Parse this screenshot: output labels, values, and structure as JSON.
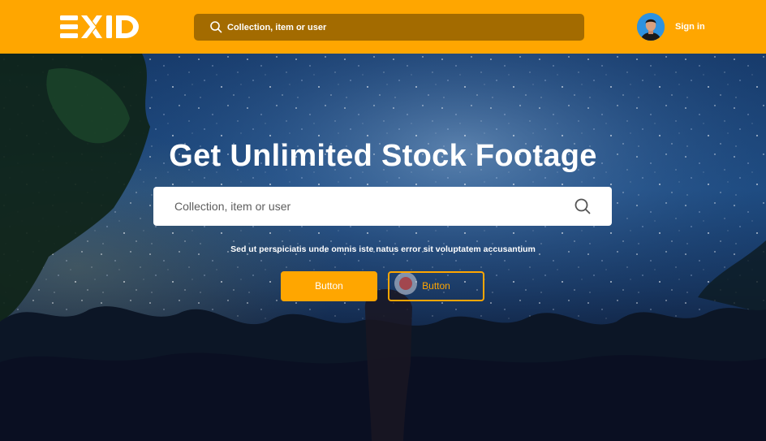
{
  "header": {
    "logo_text": "EXID",
    "search": {
      "placeholder": "Collection, item or user"
    },
    "signin_label": "Sign in"
  },
  "hero": {
    "title": "Get Unlimited Stock Footage",
    "search": {
      "placeholder": "Collection, item or user"
    },
    "subtitle": "Sed ut perspiciatis unde omnis iste natus error sit voluptatem accusantium",
    "primary_button": "Button",
    "secondary_button": "Button"
  },
  "colors": {
    "brand": "#ffa600",
    "nav_search_bg": "#a36b00",
    "text_light": "#ffffff",
    "hero_dark": "#0b0e22"
  },
  "icons": [
    "search-icon",
    "avatar",
    "logo"
  ]
}
